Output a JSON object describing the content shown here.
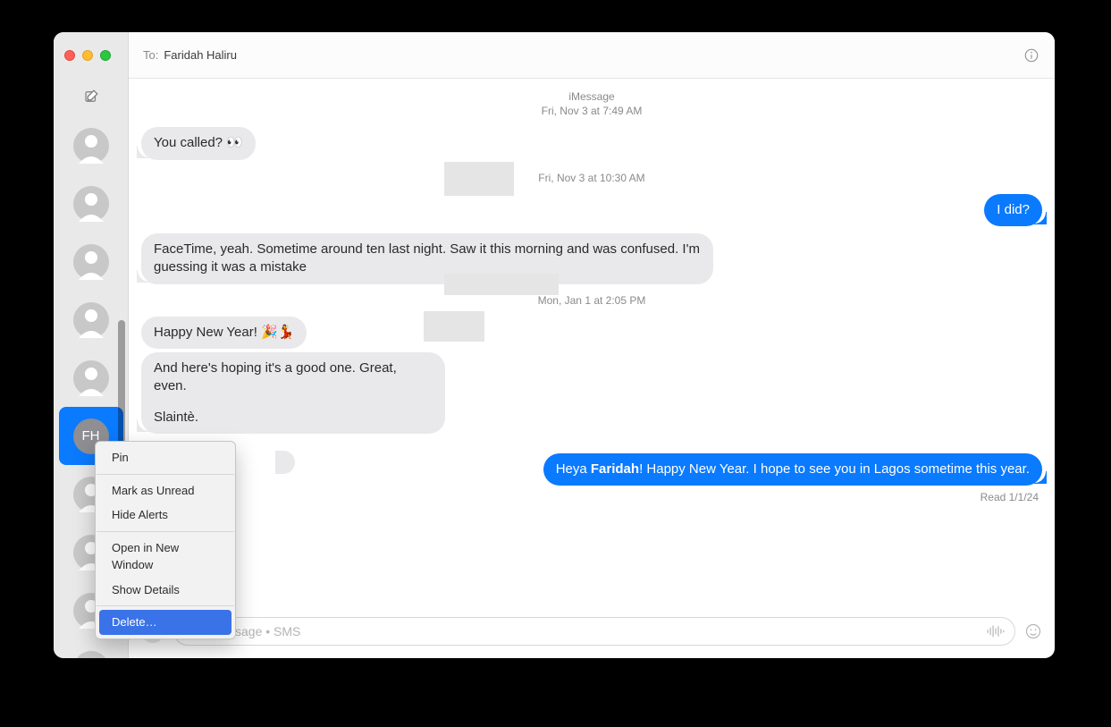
{
  "header": {
    "to_label": "To:",
    "recipient": "Faridah Haliru"
  },
  "sidebar": {
    "selected_initials": "FH"
  },
  "meta": {
    "service": "iMessage",
    "ts1": "Fri, Nov 3 at 7:49 AM",
    "ts2": "Fri, Nov 3 at 10:30 AM",
    "ts3": "Mon, Jan 1 at 2:05 PM"
  },
  "messages": {
    "m1": "You called? 👀",
    "m2": "I did?",
    "m3": "FaceTime, yeah. Sometime around ten last night. Saw it this morning and was confused. I'm guessing it was a mistake",
    "m4": "Happy New Year! 🎉💃",
    "m5a": "And here's hoping it's a good one. Great, even.",
    "m5b": "Slaintè.",
    "m6_pre": "Heya ",
    "m6_bold": "Faridah",
    "m6_post": "! Happy New Year. I hope to see you in Lagos sometime this year."
  },
  "read_receipt": "Read 1/1/24",
  "composer": {
    "placeholder": "Text Message • SMS"
  },
  "context_menu": {
    "pin": "Pin",
    "unread": "Mark as Unread",
    "hide": "Hide Alerts",
    "open": "Open in New Window",
    "details": "Show Details",
    "delete": "Delete…"
  }
}
